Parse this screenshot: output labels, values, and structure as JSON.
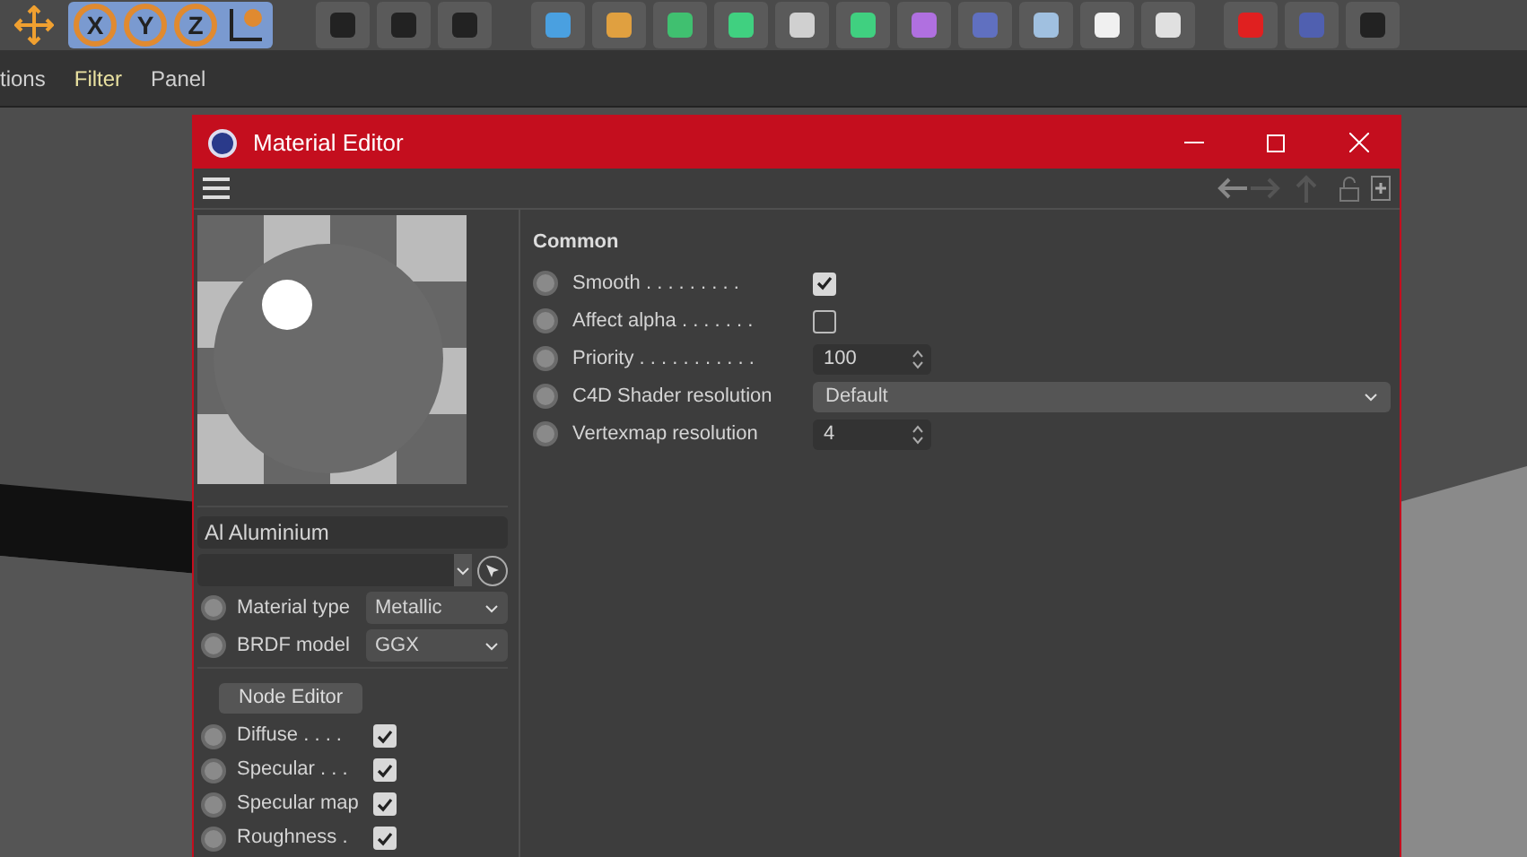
{
  "toolbar": {
    "axis_buttons": [
      "X",
      "Y",
      "Z"
    ]
  },
  "menu": [
    {
      "label": "tions",
      "highlighted": false
    },
    {
      "label": "Filter",
      "highlighted": true
    },
    {
      "label": "Panel",
      "highlighted": false
    }
  ],
  "window": {
    "title": "Material Editor"
  },
  "material": {
    "name": "Al Aluminium",
    "selects": [
      {
        "label": "Material type",
        "value": "Metallic"
      },
      {
        "label": "BRDF model",
        "value": "GGX"
      }
    ],
    "node_editor_button": "Node Editor",
    "channels": [
      {
        "label": "Diffuse . . . .",
        "checked": true
      },
      {
        "label": "Specular . . .",
        "checked": true
      },
      {
        "label": "Specular map",
        "checked": true
      },
      {
        "label": "Roughness .",
        "checked": true
      }
    ]
  },
  "section": {
    "title": "Common",
    "rows": [
      {
        "kind": "checkbox",
        "label": "Smooth . . . . . . . . .",
        "checked": true
      },
      {
        "kind": "checkbox",
        "label": "Affect alpha . . . . . . .",
        "checked": false
      },
      {
        "kind": "number",
        "label": "Priority . . . . . . . . . . .",
        "value": "100"
      },
      {
        "kind": "dropdown",
        "label": "C4D Shader resolution",
        "value": "Default"
      },
      {
        "kind": "number",
        "label": "Vertexmap resolution",
        "value": "4"
      }
    ]
  }
}
